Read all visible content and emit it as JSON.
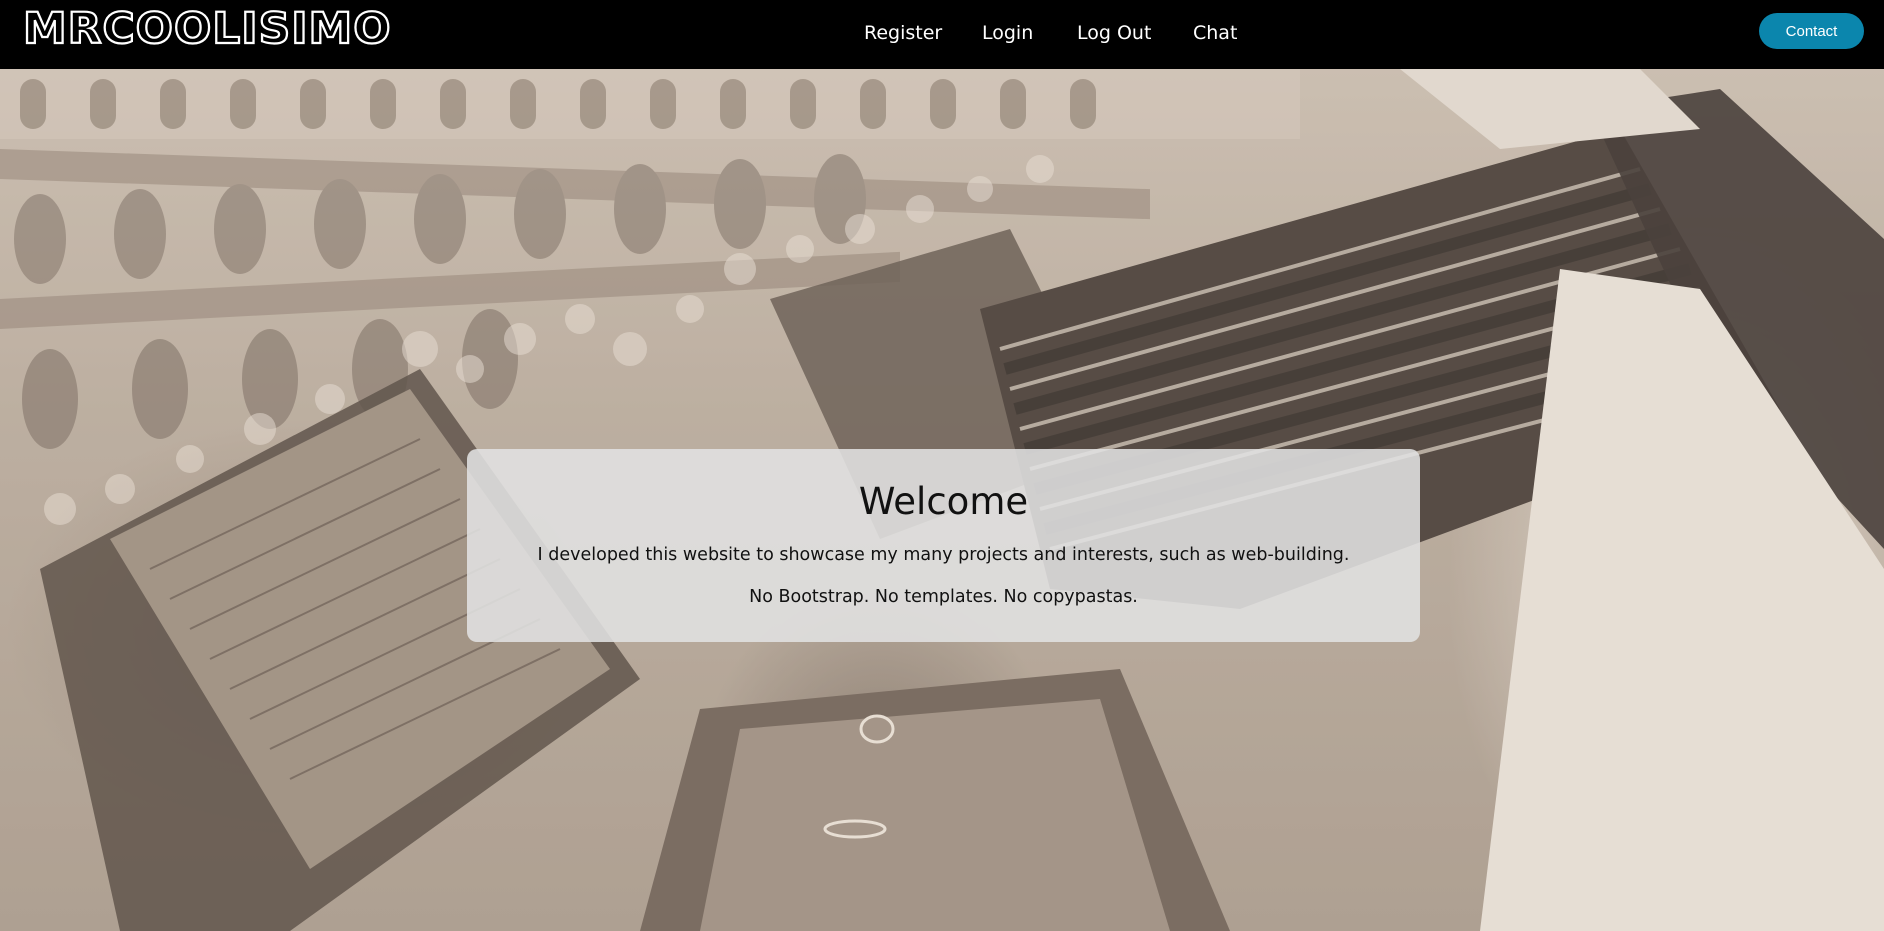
{
  "header": {
    "logo_text": "MRCOOLISIMO",
    "nav": [
      {
        "label": "Register"
      },
      {
        "label": "Login"
      },
      {
        "label": "Log Out"
      },
      {
        "label": "Chat"
      }
    ],
    "contact_label": "Contact"
  },
  "hero": {
    "image": "sepia-accordion-concert-photo"
  },
  "welcome": {
    "title": "Welcome",
    "line1": "I developed this website to showcase my many projects and interests, such as web-building.",
    "line2": "No Bootstrap. No templates. No copypastas."
  },
  "colors": {
    "header_bg": "#000000",
    "contact_button": "#0b86ad",
    "card_bg": "#e1e1e1"
  }
}
